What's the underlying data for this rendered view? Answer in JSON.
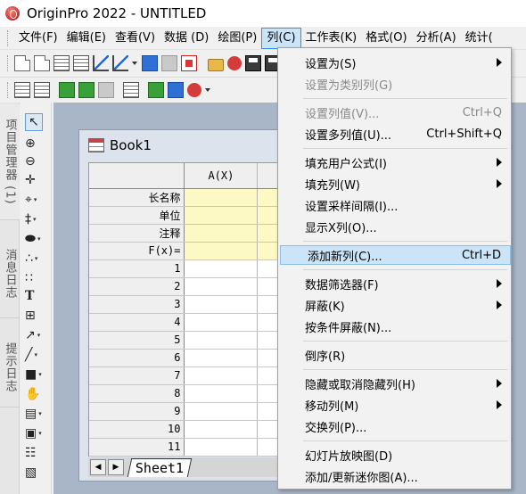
{
  "window": {
    "title": "OriginPro 2022 - UNTITLED"
  },
  "menubar": {
    "items": [
      {
        "label": "文件(F)"
      },
      {
        "label": "编辑(E)"
      },
      {
        "label": "查看(V)"
      },
      {
        "label": "数据 (D)"
      },
      {
        "label": "绘图(P)"
      },
      {
        "label": "列(C)"
      },
      {
        "label": "工作表(K)"
      },
      {
        "label": "格式(O)"
      },
      {
        "label": "分析(A)"
      },
      {
        "label": "统计("
      }
    ]
  },
  "left_panel": {
    "tabs": [
      {
        "label": "项目管理器 (1)"
      },
      {
        "label": "消息日志"
      },
      {
        "label": "提示日志"
      }
    ]
  },
  "workbook": {
    "title": "Book1",
    "columns": [
      "A(X)",
      ""
    ],
    "meta_rows": [
      "长名称",
      "单位",
      "注释",
      "F(x)="
    ],
    "data_rows": [
      "1",
      "2",
      "3",
      "4",
      "5",
      "6",
      "7",
      "8",
      "9",
      "10",
      "11"
    ],
    "sheet_tab": "Sheet1"
  },
  "column_menu": {
    "items": [
      {
        "label": "设置为(S)",
        "shortcut": "",
        "submenu": true,
        "disabled": false
      },
      {
        "label": "设置为类别列(G)",
        "shortcut": "",
        "submenu": false,
        "disabled": true
      },
      {
        "label": "设置列值(V)...",
        "shortcut": "Ctrl+Q",
        "submenu": false,
        "disabled": true
      },
      {
        "label": "设置多列值(U)...",
        "shortcut": "Ctrl+Shift+Q",
        "submenu": false,
        "disabled": false
      },
      {
        "label": "填充用户公式(I)",
        "shortcut": "",
        "submenu": true,
        "disabled": false
      },
      {
        "label": "填充列(W)",
        "shortcut": "",
        "submenu": true,
        "disabled": false
      },
      {
        "label": "设置采样间隔(I)...",
        "shortcut": "",
        "submenu": false,
        "disabled": false
      },
      {
        "label": "显示X列(O)...",
        "shortcut": "",
        "submenu": false,
        "disabled": false
      },
      {
        "label": "添加新列(C)...",
        "shortcut": "Ctrl+D",
        "submenu": false,
        "disabled": false,
        "highlighted": true
      },
      {
        "label": "数据筛选器(F)",
        "shortcut": "",
        "submenu": true,
        "disabled": false
      },
      {
        "label": "屏蔽(K)",
        "shortcut": "",
        "submenu": true,
        "disabled": false
      },
      {
        "label": "按条件屏蔽(N)...",
        "shortcut": "",
        "submenu": false,
        "disabled": false
      },
      {
        "label": "倒序(R)",
        "shortcut": "",
        "submenu": false,
        "disabled": false
      },
      {
        "label": "隐藏或取消隐藏列(H)",
        "shortcut": "",
        "submenu": true,
        "disabled": false
      },
      {
        "label": "移动列(M)",
        "shortcut": "",
        "submenu": true,
        "disabled": false
      },
      {
        "label": "交换列(P)...",
        "shortcut": "",
        "submenu": false,
        "disabled": false
      },
      {
        "label": "幻灯片放映图(D)",
        "shortcut": "",
        "submenu": false,
        "disabled": false
      },
      {
        "label": "添加/更新迷你图(A)...",
        "shortcut": "",
        "submenu": false,
        "disabled": false
      }
    ]
  },
  "colors": {
    "menu_highlight": "#cce4f7",
    "meta_row_bg": "#fdf9c4",
    "mdi_bg": "#a9b6c8"
  }
}
